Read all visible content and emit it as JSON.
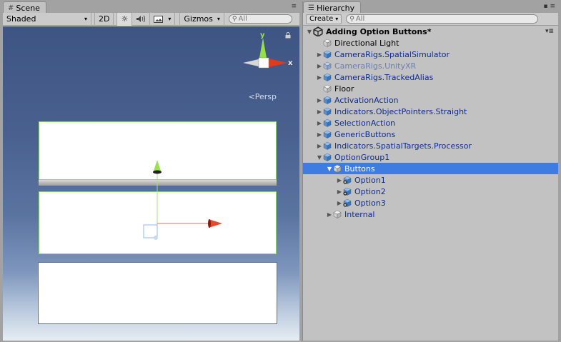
{
  "scene": {
    "tab_label": "Scene",
    "toolbar": {
      "shading_mode": "Shaded",
      "mode_2d": "2D",
      "gizmos_label": "Gizmos",
      "search_placeholder": "All"
    },
    "view_label": "Persp",
    "gizmo_axes": {
      "y": "y",
      "x": "x"
    }
  },
  "hierarchy": {
    "tab_label": "Hierarchy",
    "create_label": "Create",
    "search_placeholder": "All",
    "scene_name": "Adding Option Buttons*",
    "items": [
      {
        "label": "Directional Light",
        "style": "plain",
        "icon": "gray-cube-icon",
        "expander": "none"
      },
      {
        "label": "CameraRigs.SpatialSimulator",
        "style": "prefab",
        "icon": "prefab-cube-icon",
        "expander": "collapsed"
      },
      {
        "label": "CameraRigs.UnityXR",
        "style": "prefab-dim",
        "icon": "prefab-cube-icon",
        "expander": "collapsed"
      },
      {
        "label": "CameraRigs.TrackedAlias",
        "style": "prefab",
        "icon": "prefab-cube-icon",
        "expander": "collapsed"
      },
      {
        "label": "Floor",
        "style": "plain",
        "icon": "gray-cube-icon",
        "expander": "none"
      },
      {
        "label": "ActivationAction",
        "style": "prefab",
        "icon": "prefab-cube-icon",
        "expander": "collapsed"
      },
      {
        "label": "Indicators.ObjectPointers.Straight",
        "style": "prefab",
        "icon": "prefab-cube-icon",
        "expander": "collapsed"
      },
      {
        "label": "SelectionAction",
        "style": "prefab",
        "icon": "prefab-cube-icon",
        "expander": "collapsed"
      },
      {
        "label": "GenericButtons",
        "style": "prefab",
        "icon": "prefab-cube-icon",
        "expander": "collapsed"
      },
      {
        "label": "Indicators.SpatialTargets.Processor",
        "style": "prefab",
        "icon": "prefab-cube-icon",
        "expander": "collapsed"
      },
      {
        "label": "OptionGroup1",
        "style": "prefab",
        "icon": "prefab-cube-icon",
        "expander": "expanded"
      },
      {
        "label": "Buttons",
        "style": "selected",
        "icon": "gray-cube-icon",
        "expander": "expanded"
      },
      {
        "label": "Option1",
        "style": "prefab",
        "icon": "prefab-variant-icon",
        "expander": "collapsed"
      },
      {
        "label": "Option2",
        "style": "prefab",
        "icon": "prefab-variant-icon",
        "expander": "collapsed"
      },
      {
        "label": "Option3",
        "style": "prefab",
        "icon": "prefab-variant-icon",
        "expander": "collapsed"
      },
      {
        "label": "Internal",
        "style": "prefab",
        "icon": "gray-cube-icon",
        "expander": "collapsed"
      }
    ]
  },
  "colors": {
    "selection": "#3e7ce2",
    "prefab_text": "#0c2d8f",
    "panel_bg": "#c2c2c2"
  }
}
